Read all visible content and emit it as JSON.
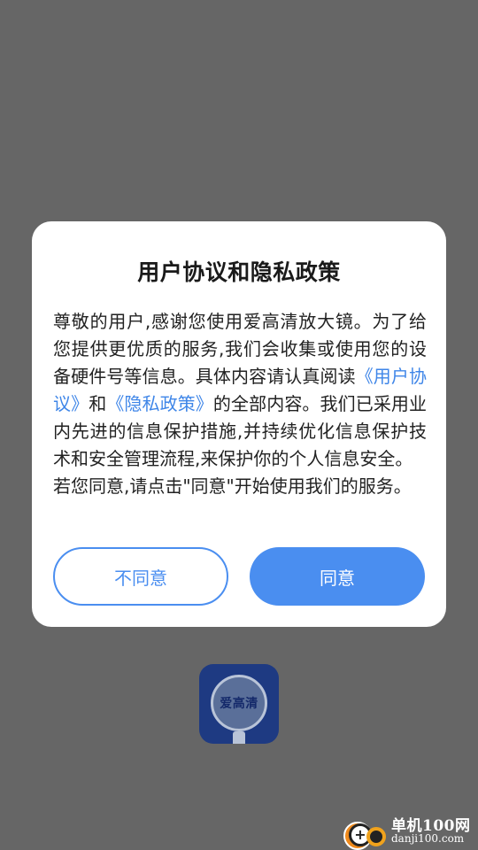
{
  "dialog": {
    "title": "用户协议和隐私政策",
    "body": {
      "part1": "尊敬的用户,感谢您使用爱高清放大镜。为了给您提供更优质的服务,我们会收集或使用您的设备硬件号等信息。具体内容请认真阅读",
      "user_agreement_link": "《用户协议》",
      "and": "和",
      "privacy_policy_link": "《隐私政策》",
      "part2": "的全部内容。我们已采用业内先进的信息保护措施,并持续优化信息保护技术和安全管理流程,来保护你的个人信息安全。",
      "part3": "若您同意,请点击\"同意\"开始使用我们的服务。"
    },
    "disagree_label": "不同意",
    "agree_label": "同意"
  },
  "app_logo": {
    "text": "爱高清"
  },
  "watermark": {
    "top_text": "单机100网",
    "bottom_text": "danji100.com",
    "icon_glyph": "+"
  },
  "colors": {
    "overlay": "#666666",
    "accent": "#4a8ef0",
    "link": "#3f86e8",
    "logo_bg": "#1e3a82"
  }
}
